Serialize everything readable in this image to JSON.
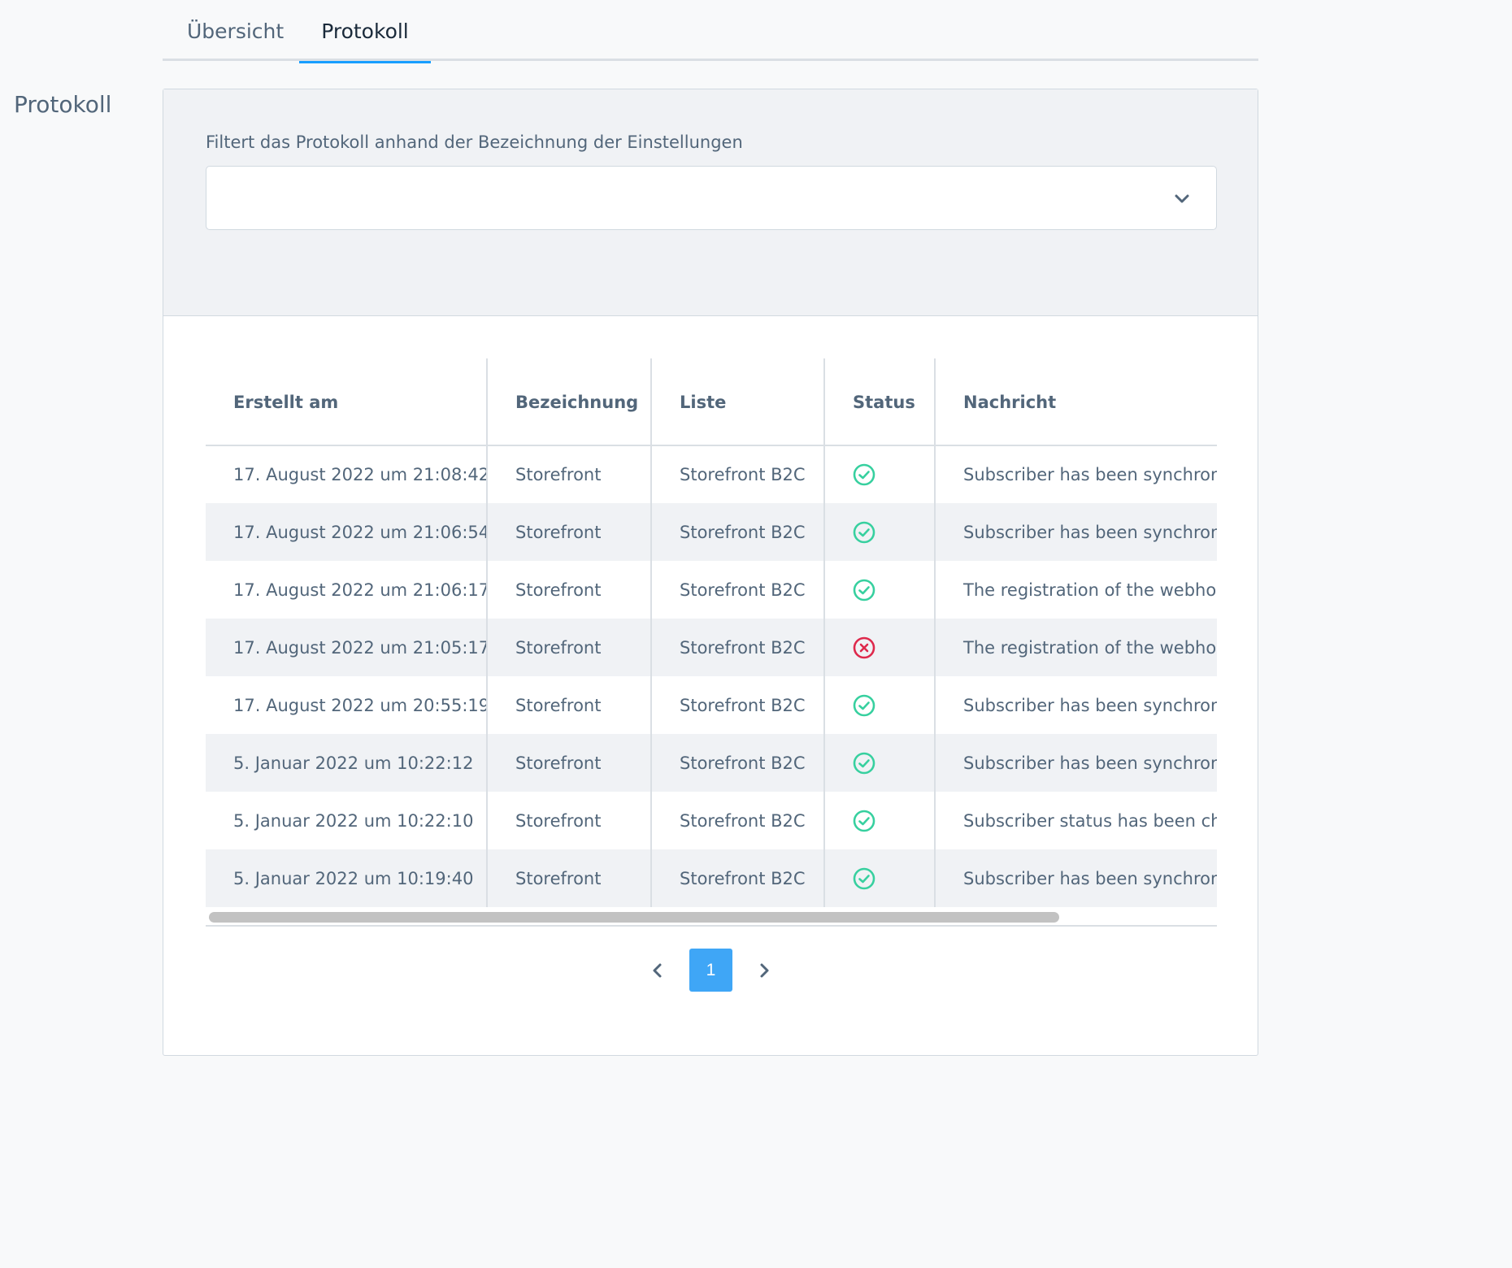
{
  "tabs": [
    {
      "label": "Übersicht"
    },
    {
      "label": "Protokoll",
      "active": true
    }
  ],
  "section_title": "Protokoll",
  "filter": {
    "label": "Filtert das Protokoll anhand der Bezeichnung der Einstellungen",
    "selected_value": ""
  },
  "table": {
    "columns": [
      "Erstellt am",
      "Bezeichnung",
      "Liste",
      "Status",
      "Nachricht"
    ],
    "rows": [
      {
        "created": "17. August 2022 um 21:08:42",
        "name": "Storefront",
        "list": "Storefront B2C",
        "status": "success",
        "message": "Subscriber has been synchronized"
      },
      {
        "created": "17. August 2022 um 21:06:54",
        "name": "Storefront",
        "list": "Storefront B2C",
        "status": "success",
        "message": "Subscriber has been synchronized"
      },
      {
        "created": "17. August 2022 um 21:06:17",
        "name": "Storefront",
        "list": "Storefront B2C",
        "status": "success",
        "message": "The registration of the webhook"
      },
      {
        "created": "17. August 2022 um 21:05:17",
        "name": "Storefront",
        "list": "Storefront B2C",
        "status": "error",
        "message": "The registration of the webhook"
      },
      {
        "created": "17. August 2022 um 20:55:19",
        "name": "Storefront",
        "list": "Storefront B2C",
        "status": "success",
        "message": "Subscriber has been synchronized"
      },
      {
        "created": "5. Januar 2022 um 10:22:12",
        "name": "Storefront",
        "list": "Storefront B2C",
        "status": "success",
        "message": "Subscriber has been synchronized"
      },
      {
        "created": "5. Januar 2022 um 10:22:10",
        "name": "Storefront",
        "list": "Storefront B2C",
        "status": "success",
        "message": "Subscriber status has been changed"
      },
      {
        "created": "5. Januar 2022 um 10:19:40",
        "name": "Storefront",
        "list": "Storefront B2C",
        "status": "success",
        "message": "Subscriber has been synchronized"
      }
    ]
  },
  "pagination": {
    "current_page": "1"
  },
  "colors": {
    "accent": "#189eff",
    "success": "#37d09f",
    "error": "#de294c",
    "page_button": "#3fa6f6"
  },
  "icons": {
    "dropdown": "chevron-down-icon",
    "success": "check-circle-icon",
    "error": "x-circle-icon",
    "prev": "chevron-left-icon",
    "next": "chevron-right-icon"
  }
}
